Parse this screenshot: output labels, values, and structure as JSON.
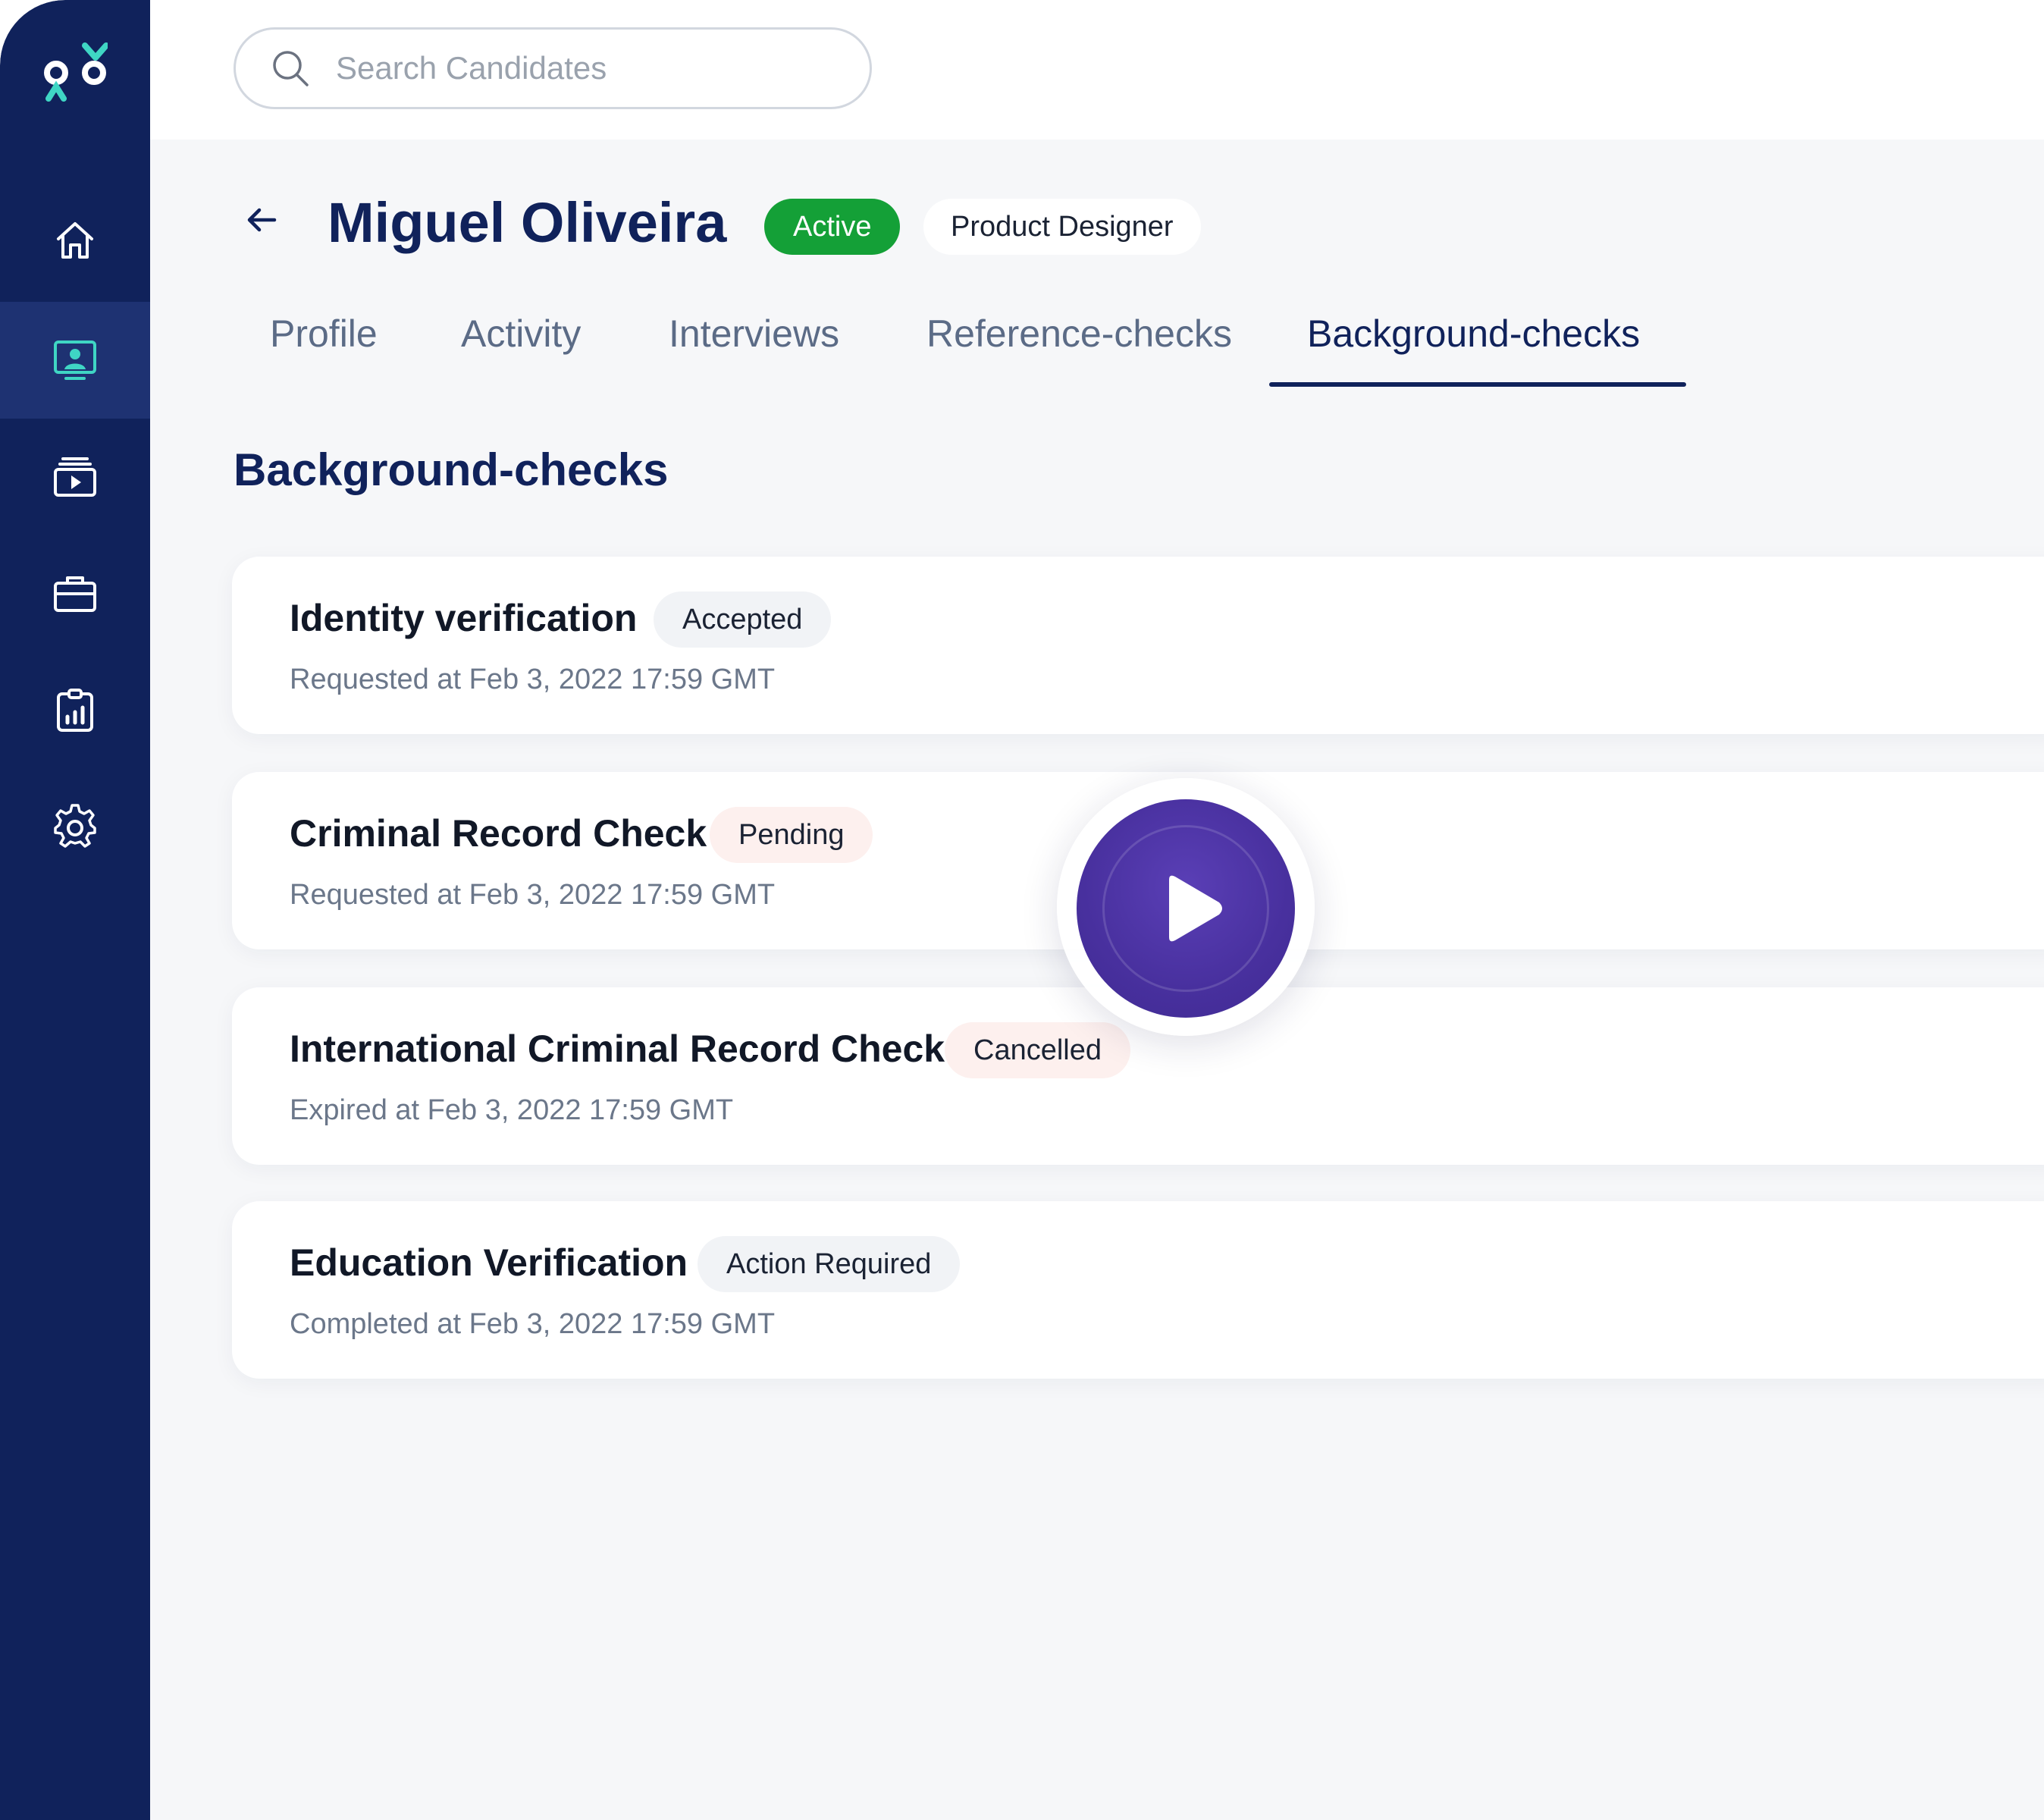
{
  "sidebar": {
    "logo_icon": "go-logo",
    "items": [
      {
        "name": "home",
        "icon": "home-icon"
      },
      {
        "name": "candidates",
        "icon": "candidate-icon",
        "active": true
      },
      {
        "name": "videos",
        "icon": "video-library-icon"
      },
      {
        "name": "jobs",
        "icon": "briefcase-icon"
      },
      {
        "name": "reports",
        "icon": "report-chart-icon"
      },
      {
        "name": "settings",
        "icon": "gear-icon"
      }
    ]
  },
  "search": {
    "placeholder": "Search Candidates",
    "value": ""
  },
  "candidate": {
    "name": "Miguel Oliveira",
    "status": "Active",
    "role": "Product Designer"
  },
  "tabs": [
    {
      "label": "Profile"
    },
    {
      "label": "Activity"
    },
    {
      "label": "Interviews"
    },
    {
      "label": "Reference-checks"
    },
    {
      "label": "Background-checks",
      "active": true
    }
  ],
  "section": {
    "title": "Background-checks"
  },
  "checks": [
    {
      "title": "Identity verification",
      "status": "Accepted",
      "subtitle": "Requested at Feb 3, 2022 17:59 GMT"
    },
    {
      "title": "Criminal Record Check",
      "status": "Pending",
      "subtitle": "Requested at Feb 3, 2022 17:59 GMT"
    },
    {
      "title": "International Criminal Record Check",
      "status": "Cancelled",
      "subtitle": "Expired at Feb 3, 2022 17:59 GMT"
    },
    {
      "title": "Education Verification",
      "status": "Action Required",
      "subtitle": "Completed at Feb 3, 2022 17:59 GMT"
    }
  ],
  "colors": {
    "sidebar": "#10225b",
    "sidebar_active": "#1e3272",
    "accent_teal": "#3fd6c4",
    "active_green": "#14a037",
    "play_purple": "#48309e"
  },
  "overlay": {
    "icon": "play-icon"
  }
}
